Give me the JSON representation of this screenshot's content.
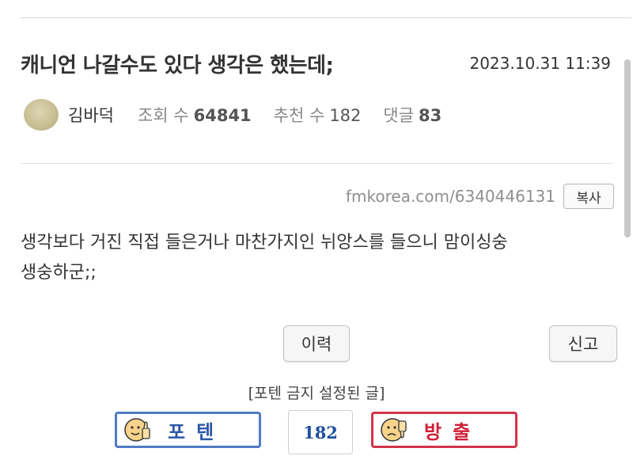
{
  "post": {
    "title": "캐니언 나갈수도 있다 생각은 했는데;",
    "date": "2023.10.31 11:39",
    "author": "김바덕",
    "views_label": "조회 수",
    "views": "64841",
    "recommend_label": "추천 수",
    "recommend": "182",
    "comments_label": "댓글",
    "comments": "83",
    "url": "fmkorea.com/6340446131",
    "copy_label": "복사",
    "content_line1": "생각보다 거진 직접 들은거나 마찬가지인 뉘앙스를 들으니 맘이싱숭",
    "content_line2": "생숭하군;;"
  },
  "actions": {
    "history_label": "이력",
    "report_label": "신고"
  },
  "vote": {
    "notice": "[포텐 금지 설정된 글]",
    "up_label": "포텐",
    "count": "182",
    "down_label": "방출",
    "up_color": "#4f7bc3",
    "down_color": "#d2344a"
  },
  "icons": {
    "avatar": "avatar-image",
    "thumbs_up": "thumbs-up-face-icon",
    "thumbs_down": "thumbs-down-face-icon"
  }
}
